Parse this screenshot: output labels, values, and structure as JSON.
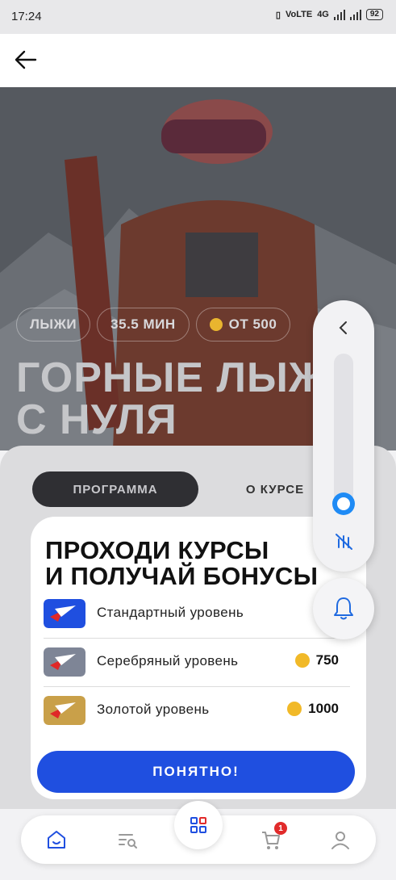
{
  "status_bar": {
    "time": "17:24",
    "network": "VoLTE",
    "network_type": "4G",
    "battery": "92"
  },
  "hero": {
    "tags": [
      "ЛЫЖИ",
      "35.5 МИН",
      "ОТ 500"
    ],
    "title_line1": "ГОРНЫЕ ЛЫЖИ",
    "title_line2": "С НУЛЯ"
  },
  "tabs": [
    "ПРОГРАММА",
    "О КУРСЕ"
  ],
  "modal": {
    "title_line1": "ПРОХОДИ КУРСЫ",
    "title_line2": "И ПОЛУЧАЙ БОНУСЫ",
    "levels": [
      {
        "name": "Стандартный уровень",
        "amount": "",
        "badge_color": "#1f4fe0"
      },
      {
        "name": "Серебряный уровень",
        "amount": "750",
        "badge_color": "#7e8596"
      },
      {
        "name": "Золотой уровень",
        "amount": "1000",
        "badge_color": "#c9a049"
      }
    ],
    "ok_label": "ПОНЯТНО!"
  },
  "nav": {
    "cart_count": "1"
  },
  "colors": {
    "accent": "#1f4fe0",
    "coin": "#f1b928",
    "badge": "#e12b2b",
    "toggle": "#1f8bf5"
  },
  "icons": [
    "back-arrow-icon",
    "chevron-left-icon",
    "mute-icon",
    "bell-icon",
    "home-icon",
    "search-list-icon",
    "grid-icon",
    "cart-icon",
    "profile-icon"
  ]
}
